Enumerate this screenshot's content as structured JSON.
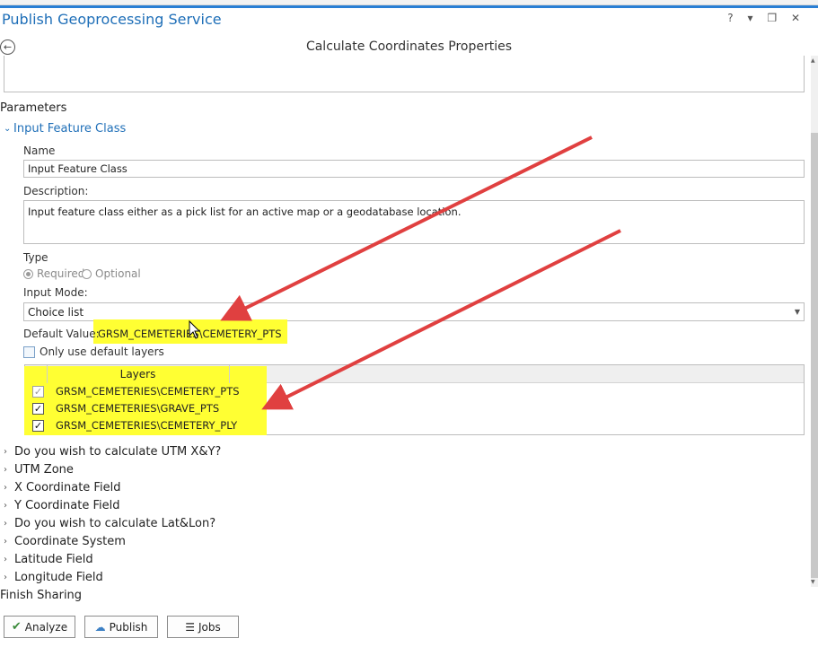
{
  "window": {
    "pane_title": "Publish Geoprocessing Service",
    "controls": [
      "?",
      "▾",
      "❐",
      "✕"
    ]
  },
  "header": {
    "title": "Calculate Coordinates Properties"
  },
  "parameters": {
    "section_label": "Parameters",
    "group_label": "Input Feature Class",
    "name_label": "Name",
    "name_value": "Input Feature Class",
    "description_label": "Description:",
    "description_value": "Input feature class either as a pick list for an active map or a geodatabase location.",
    "type_label": "Type",
    "type_options": [
      {
        "label": "Required",
        "selected": true
      },
      {
        "label": "Optional",
        "selected": false
      }
    ],
    "input_mode_label": "Input Mode:",
    "input_mode_value": "Choice list",
    "default_value_label": "Default Value:",
    "default_value": "GRSM_CEMETERIES\\CEMETERY_PTS",
    "only_default_label": "Only use default layers",
    "only_default_checked": false,
    "layers_header": "Layers",
    "layers": [
      {
        "name": "GRSM_CEMETERIES\\CEMETERY_PTS",
        "checked": true,
        "disabled": true
      },
      {
        "name": "GRSM_CEMETERIES\\GRAVE_PTS",
        "checked": true,
        "disabled": false
      },
      {
        "name": "GRSM_CEMETERIES\\CEMETERY_PLY",
        "checked": true,
        "disabled": false
      }
    ],
    "collapsed_groups": [
      "Do you wish to calculate UTM X&Y?",
      "UTM Zone",
      "X Coordinate Field",
      "Y Coordinate Field",
      "Do you wish to calculate Lat&Lon?",
      "Coordinate System",
      "Latitude Field",
      "Longitude Field"
    ]
  },
  "finish": {
    "section_label": "Finish Sharing",
    "buttons": [
      {
        "label": "Analyze",
        "icon": "check-icon"
      },
      {
        "label": "Publish",
        "icon": "cloud-icon"
      },
      {
        "label": "Jobs",
        "icon": "list-icon"
      }
    ]
  },
  "colors": {
    "accent_blue": "#1f6fb8",
    "highlight_yellow": "#ffff33",
    "annotation_red": "#e04040"
  }
}
